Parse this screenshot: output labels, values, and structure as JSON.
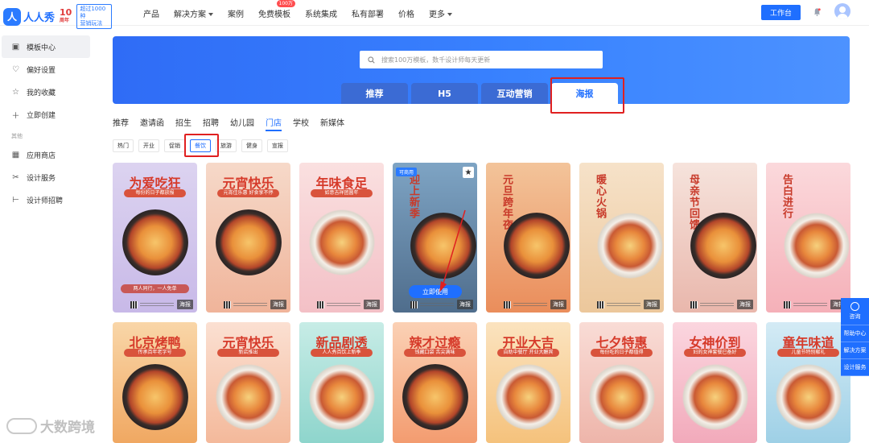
{
  "header": {
    "logo_mark": "人",
    "logo_text": "人人秀",
    "logo_ten": "10",
    "logo_ten_sub": "周年",
    "logo_badge_line1": "超过1000种",
    "logo_badge_line2": "营销玩法",
    "nav": [
      {
        "label": "产品",
        "caret": false,
        "hot": ""
      },
      {
        "label": "解决方案",
        "caret": true,
        "hot": ""
      },
      {
        "label": "案例",
        "caret": false,
        "hot": ""
      },
      {
        "label": "免费模板",
        "caret": false,
        "hot": "100万"
      },
      {
        "label": "系统集成",
        "caret": false,
        "hot": ""
      },
      {
        "label": "私有部署",
        "caret": false,
        "hot": ""
      },
      {
        "label": "价格",
        "caret": false,
        "hot": ""
      },
      {
        "label": "更多",
        "caret": true,
        "hot": ""
      }
    ],
    "workbench_label": "工作台"
  },
  "sidebar": {
    "items": [
      {
        "label": "模板中心",
        "icon": "template-icon",
        "glyph": "▣",
        "active": true
      },
      {
        "label": "偏好设置",
        "icon": "heart-icon",
        "glyph": "♡",
        "active": false
      },
      {
        "label": "我的收藏",
        "icon": "star-icon",
        "glyph": "☆",
        "active": false
      },
      {
        "label": "立即创建",
        "icon": "plus-icon",
        "glyph": "＋",
        "active": false
      }
    ],
    "section_label": "其他",
    "other_items": [
      {
        "label": "应用商店",
        "icon": "app-store-icon",
        "glyph": "▦"
      },
      {
        "label": "设计服务",
        "icon": "design-service-icon",
        "glyph": "✂"
      },
      {
        "label": "设计师招聘",
        "icon": "recruit-icon",
        "glyph": "⊢"
      }
    ]
  },
  "search": {
    "placeholder": "搜索100万模板，数千设计师每天更新"
  },
  "category_tabs": [
    {
      "label": "推荐",
      "active": false
    },
    {
      "label": "H5",
      "active": false
    },
    {
      "label": "互动营销",
      "active": false
    },
    {
      "label": "海报",
      "active": true
    }
  ],
  "sub_tabs": [
    {
      "label": "推荐",
      "active": false
    },
    {
      "label": "邀请函",
      "active": false
    },
    {
      "label": "招生",
      "active": false
    },
    {
      "label": "招聘",
      "active": false
    },
    {
      "label": "幼儿园",
      "active": false
    },
    {
      "label": "门店",
      "active": true
    },
    {
      "label": "学校",
      "active": false
    },
    {
      "label": "新媒体",
      "active": false
    }
  ],
  "filter_chips": [
    {
      "label": "热门",
      "active": false
    },
    {
      "label": "开业",
      "active": false
    },
    {
      "label": "促销",
      "active": false
    },
    {
      "label": "餐饮",
      "active": true
    },
    {
      "label": "旅游",
      "active": false
    },
    {
      "label": "健身",
      "active": false
    },
    {
      "label": "宣报",
      "active": false
    }
  ],
  "cards": [
    {
      "title": "为爱吃狂",
      "sub": "每份的日子都放报",
      "tag": "两人同行，一人免单",
      "badge": "海报",
      "bg": "#dcd3f0",
      "bg2": "#c8b9e8",
      "vertical": false,
      "free": false,
      "use": "",
      "light": false
    },
    {
      "title": "元宵快乐",
      "sub": "元宵佳乐惠 好食享不停",
      "tag": "",
      "badge": "海报",
      "bg": "#f6d9c9",
      "bg2": "#f0b49a",
      "vertical": false,
      "free": false,
      "use": "",
      "light": false
    },
    {
      "title": "年味食足",
      "sub": "如意吉祥团圆年",
      "tag": "",
      "badge": "海报",
      "bg": "#fae0e0",
      "bg2": "#f3c0c6",
      "vertical": false,
      "free": false,
      "use": "",
      "light": true
    },
    {
      "title": "迎上新季",
      "sub": "",
      "tag": "",
      "badge": "海报",
      "bg": "#7ea4c4",
      "bg2": "#4f6d8c",
      "vertical": true,
      "free": true,
      "free_label": "可商用",
      "use": "立即使用",
      "light": false
    },
    {
      "title": "元旦跨年夜",
      "sub": "",
      "tag": "",
      "badge": "海报",
      "bg": "#f3c49a",
      "bg2": "#ea8d5b",
      "vertical": true,
      "free": false,
      "use": "",
      "light": false
    },
    {
      "title": "暖心火锅",
      "sub": "",
      "tag": "",
      "badge": "海报",
      "bg": "#f6e2c9",
      "bg2": "#ecc79b",
      "vertical": true,
      "free": false,
      "use": "",
      "light": true
    },
    {
      "title": "母亲节回馈",
      "sub": "",
      "tag": "",
      "badge": "海报",
      "bg": "#f6e3dc",
      "bg2": "#e9b7ac",
      "vertical": true,
      "free": false,
      "use": "",
      "light": false
    },
    {
      "title": "告白进行",
      "sub": "",
      "tag": "",
      "badge": "海报",
      "bg": "#fbd9dc",
      "bg2": "#f5b0b8",
      "vertical": true,
      "free": false,
      "use": "",
      "light": true
    },
    {
      "title": "北京烤鸭",
      "sub": "传承百年老字号",
      "tag": "",
      "badge": "",
      "bg": "#f9d6a8",
      "bg2": "#f0a862",
      "vertical": false,
      "free": false,
      "use": "",
      "light": false
    },
    {
      "title": "元宵快乐",
      "sub": "新店推出",
      "tag": "",
      "badge": "",
      "bg": "#fbe0d2",
      "bg2": "#f4b99b",
      "vertical": false,
      "free": false,
      "use": "",
      "light": true
    },
    {
      "title": "新品剧透",
      "sub": "人人秀百饮上新季",
      "tag": "",
      "badge": "",
      "bg": "#c7ece6",
      "bg2": "#8ed5cc",
      "vertical": false,
      "free": false,
      "use": "",
      "light": true
    },
    {
      "title": "辣才过瘾",
      "sub": "钱藏口袋 舌尖满味",
      "tag": "",
      "badge": "",
      "bg": "#fbd1b5",
      "bg2": "#f39c70",
      "vertical": false,
      "free": false,
      "use": "",
      "light": false
    },
    {
      "title": "开业大吉",
      "sub": "自助中餐厅 开业大酬宾",
      "tag": "",
      "badge": "",
      "bg": "#fbe3bf",
      "bg2": "#f5c27c",
      "vertical": false,
      "free": false,
      "use": "",
      "light": true
    },
    {
      "title": "七夕特惠",
      "sub": "每份吃的日子都值得",
      "tag": "",
      "badge": "",
      "bg": "#f9dcd6",
      "bg2": "#eeb5aa",
      "vertical": false,
      "free": false,
      "use": "",
      "light": true
    },
    {
      "title": "女神价到",
      "sub": "妇的女神套餐已备好",
      "tag": "",
      "badge": "",
      "bg": "#fbd6df",
      "bg2": "#f2aabb",
      "vertical": false,
      "free": false,
      "use": "",
      "light": true
    },
    {
      "title": "童年味道",
      "sub": "儿童节特别献礼",
      "tag": "",
      "badge": "",
      "bg": "#d4ebf5",
      "bg2": "#9ed0e6",
      "vertical": false,
      "free": false,
      "use": "",
      "light": true
    }
  ],
  "floating_tools": [
    "咨询",
    "帮助中心",
    "解决方案",
    "设计服务"
  ],
  "watermark": "大数跨境",
  "colors": {
    "brand": "#1f6fff",
    "highlight": "#e02020"
  }
}
